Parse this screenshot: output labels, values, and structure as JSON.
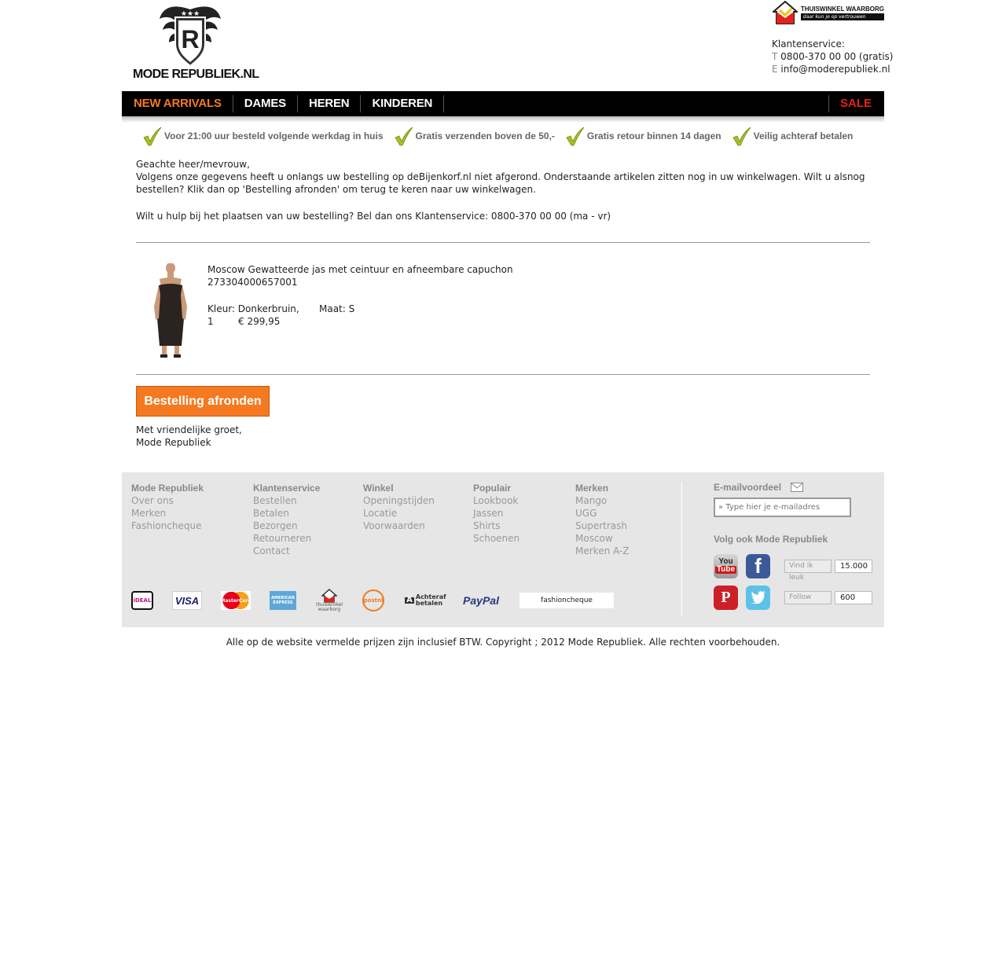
{
  "header": {
    "logo_text": "MODE REPUBLIEK.NL",
    "logo_letter": "R",
    "trust_title": "THUISWINKEL WAARBORG",
    "trust_sub": "daar kun je op vertrouwen",
    "service_label": "Klantenservice:",
    "phone_prefix": "T",
    "phone": "0800-370 00 00 (gratis)",
    "email_prefix": "E",
    "email": "info@moderepubliek.nl"
  },
  "nav": {
    "items": [
      "NEW ARRIVALS",
      "DAMES",
      "HEREN",
      "KINDEREN"
    ],
    "sale": "SALE"
  },
  "usps": [
    "Voor 21:00 uur besteld volgende werkdag in huis",
    "Gratis verzenden boven de 50,-",
    "Gratis retour binnen 14 dagen",
    "Veilig achteraf betalen"
  ],
  "content": {
    "salutation": "Geachte heer/mevrouw,",
    "message": "Volgens onze gegevens heeft u onlangs uw bestelling op deBijenkorf.nl niet afgerond. Onderstaande artikelen zitten nog in uw winkelwagen. Wilt u alsnog bestellen? Klik dan op 'Bestelling afronden' om terug te keren naar uw winkelwagen.",
    "help": "Wilt u hulp bij het plaatsen van uw bestelling? Bel dan ons Klantenservice: 0800-370 00 00 (ma - vr)",
    "greeting1": "Met vriendelijke groet,",
    "greeting2": "Mode Republiek"
  },
  "product": {
    "name": "Moscow Gewatteerde jas met ceintuur en afneembare capuchon",
    "sku": "273304000657001",
    "color_label": "Kleur: Donkerbruin,",
    "size_label": "Maat: S",
    "quantity": "1",
    "price": "€ 299,95"
  },
  "checkout_button": "Bestelling afronden",
  "footer": {
    "columns": [
      {
        "heading": "Mode Republiek",
        "links": [
          "Over ons",
          "Merken",
          "Fashioncheque"
        ]
      },
      {
        "heading": "Klantenservice",
        "links": [
          "Bestellen",
          "Betalen",
          "Bezorgen",
          "Retourneren",
          "Contact"
        ]
      },
      {
        "heading": "Winkel",
        "links": [
          "Openingstijden",
          "Locatie",
          "Voorwaarden"
        ]
      },
      {
        "heading": "Populair",
        "links": [
          "Lookbook",
          "Jassen",
          "Shirts",
          "Schoenen"
        ]
      },
      {
        "heading": "Merken",
        "links": [
          "Mango",
          "UGG",
          "Supertrash",
          "Moscow",
          "Merken A-Z"
        ]
      }
    ],
    "newsletter_heading": "E-mailvoordeel",
    "newsletter_placeholder": "» Type hier je e-mailadres",
    "follow_heading": "Volg ook Mode Republiek",
    "facebook_button": "Vind ik leuk",
    "facebook_count": "15.000",
    "twitter_button": "Follow",
    "twitter_count": "600",
    "payments": [
      "iDEAL",
      "VISA",
      "MasterCard",
      "AMERICAN EXPRESS",
      "thuiswinkel waarborg",
      "postnl",
      "Achteraf betalen",
      "PayPal",
      "fashioncheque"
    ],
    "youtube_label": "You Tube",
    "pinterest_label": "Pinterest"
  },
  "copyright": "Alle op de website vermelde prijzen zijn inclusief BTW. Copyright ; 2012 Mode Republiek. Alle rechten voorbehouden.",
  "colors": {
    "accent": "#f47920",
    "sale": "#e4221b",
    "nav_bg": "#000000",
    "check": "#a6c21f",
    "footer_bg": "#e6e6e6"
  }
}
